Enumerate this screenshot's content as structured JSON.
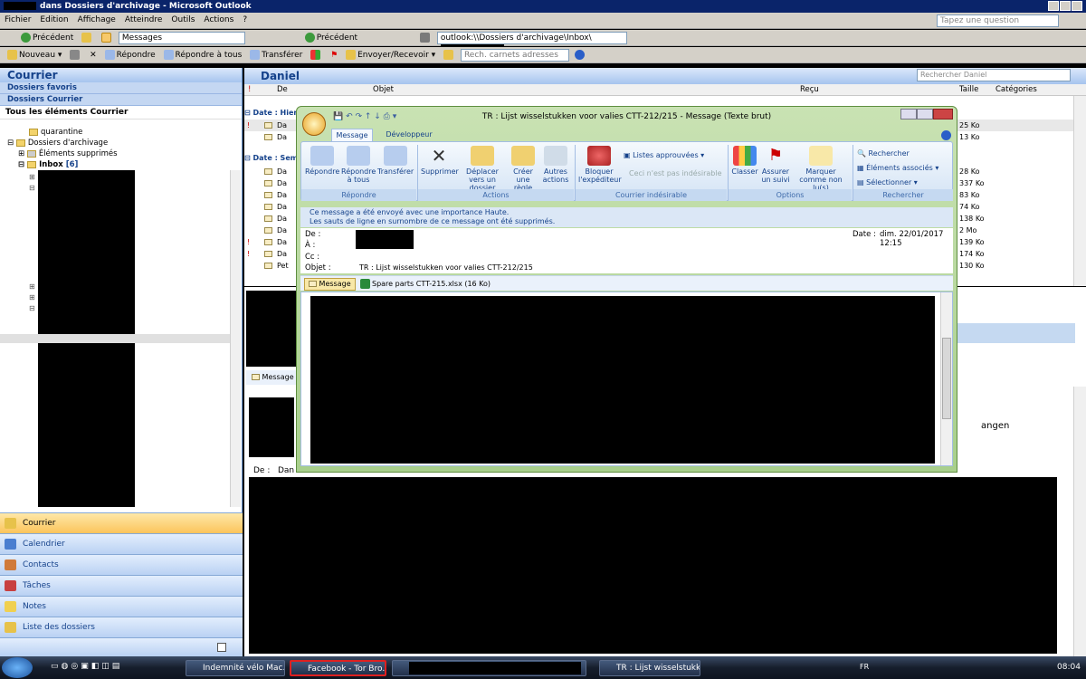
{
  "window": {
    "title_suffix": "dans Dossiers d'archivage - Microsoft Outlook"
  },
  "menu": [
    "Fichier",
    "Edition",
    "Affichage",
    "Atteindre",
    "Outils",
    "Actions",
    "?"
  ],
  "help_placeholder": "Tapez une question",
  "toolbar1": {
    "back": "Précédent",
    "view": "Messages",
    "back2": "Précédent",
    "address": "outlook:\\\\Dossiers d'archivage\\Inbox\\"
  },
  "toolbar2": {
    "new": "Nouveau",
    "reply": "Répondre",
    "reply_all": "Répondre à tous",
    "forward": "Transférer",
    "send_receive": "Envoyer/Recevoir",
    "address_book": "Rech. carnets adresses"
  },
  "nav": {
    "title": "Courrier",
    "favorites": "Dossiers favoris",
    "mail_folders": "Dossiers Courrier",
    "all_items": "Tous les éléments Courrier",
    "tree": [
      {
        "label": "quarantine"
      },
      {
        "label": "Dossiers d'archivage"
      },
      {
        "label": "Éléments supprimés"
      },
      {
        "label": "Inbox",
        "count": "[6]"
      }
    ],
    "buttons": [
      "Courrier",
      "Calendrier",
      "Contacts",
      "Tâches",
      "Notes",
      "Liste des dossiers"
    ]
  },
  "list": {
    "folder_title": "Daniel",
    "search_placeholder": "Rechercher Daniel",
    "columns": {
      "from": "De",
      "subject": "Objet",
      "received": "Reçu",
      "size": "Taille",
      "categories": "Catégories"
    },
    "group1": "Date : Hier",
    "group2": "Date : Sema",
    "sizes_group1": [
      "25 Ko",
      "13 Ko"
    ],
    "sizes_group2": [
      "28 Ko",
      "337 Ko",
      "83 Ko",
      "74 Ko",
      "138 Ko",
      "2 Mo",
      "139 Ko",
      "174 Ko",
      "130 Ko"
    ],
    "from_prefix": [
      "Da",
      "Da",
      "Da",
      "Da",
      "Da",
      "Da",
      "Da",
      "Da",
      "Da",
      "Da",
      "Pet"
    ]
  },
  "reading": {
    "tab": "Message",
    "from_label": "De :",
    "from_value": "Dan",
    "extra": "angen",
    "partial": "ssage"
  },
  "message": {
    "title": "TR : Lijst wisselstukken voor valies CTT-212/215 - Message (Texte brut)",
    "tabs": [
      "Message",
      "Développeur"
    ],
    "ribbon": {
      "reply": "Répondre",
      "reply_all": "Répondre à tous",
      "forward": "Transférer",
      "delete": "Supprimer",
      "move": "Déplacer vers un dossier",
      "create_rule": "Créer une règle",
      "other_actions": "Autres actions",
      "block": "Bloquer l'expéditeur",
      "safe_lists": "Listes approuvées",
      "not_junk": "Ceci n'est pas indésirable",
      "categorize": "Classer",
      "follow_up": "Assurer un suivi",
      "mark_unread": "Marquer comme non lu(s)",
      "find": "Rechercher",
      "related": "Éléments associés",
      "select": "Sélectionner",
      "groups": [
        "Répondre",
        "Actions",
        "Courrier indésirable",
        "Options",
        "Rechercher"
      ]
    },
    "info1": "Ce message a été envoyé avec une importance Haute.",
    "info2": "Les sauts de ligne en surnombre de ce message ont été supprimés.",
    "from_label": "De :",
    "to_label": "À :",
    "cc_label": "Cc :",
    "subject_label": "Objet :",
    "subject": "TR : Lijst wisselstukken voor valies CTT-212/215",
    "date_label": "Date :",
    "date": "dim. 22/01/2017 12:15",
    "att_message": "Message",
    "attachment": "Spare parts CTT-215.xlsx (16 Ko)"
  },
  "taskbar": {
    "tasks": [
      "Indemnité vélo Mac...",
      "Facebook - Tor Bro...",
      "",
      "TR : Lijst wisselstukk..."
    ],
    "lang": "FR",
    "time": "08:04"
  },
  "colors": {
    "nav_blue": "#15428b",
    "active_nav": "#fbc45b",
    "highlight_task": "#e02020"
  }
}
